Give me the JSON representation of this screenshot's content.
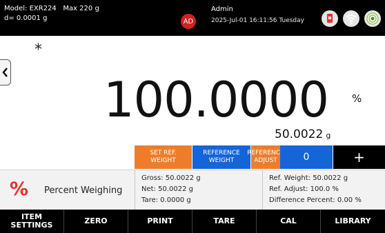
{
  "header": {
    "model": "Model: EXR224",
    "max": "Max 220 g",
    "resolution": "d= 0.0001 g",
    "avatar_initials": "AD",
    "user": "Admin",
    "datetime": "2025-Jul-01 16:11:56 Tuesday",
    "status_icons": [
      "usb-icon",
      "wifi-icon",
      "target-icon"
    ]
  },
  "display": {
    "stable_marker": "*",
    "main_value": "100.0000",
    "main_unit": "%",
    "sub_value": "50.0022",
    "sub_unit": "g"
  },
  "function_buttons": {
    "set_ref_weight": "SET REF.\nWEIGHT",
    "reference_weight": "REFERENCE\nWEIGHT",
    "reference_adjust": "REFERENCE\nADJUST",
    "value": "0",
    "plus": "+"
  },
  "info": {
    "mode_icon": "%",
    "mode_label": "Percent Weighing",
    "gross": "Gross: 50.0022 g",
    "net": "Net: 50.0022 g",
    "tare": "Tare: 0.0000 g",
    "ref_weight": "Ref. Weight: 50.0022 g",
    "ref_adjust": "Ref. Adjust: 100.0 %",
    "difference_percent": "Difference Percent: 0.00 %"
  },
  "nav": {
    "item_settings": "ITEM\nSETTINGS",
    "zero": "ZERO",
    "print": "PRINT",
    "tare": "TARE",
    "cal": "CAL",
    "library": "LIBRARY"
  },
  "colors": {
    "orange": "#ee7d2b",
    "blue": "#1565d8",
    "red": "#e8302b",
    "avatar": "#d32020"
  }
}
